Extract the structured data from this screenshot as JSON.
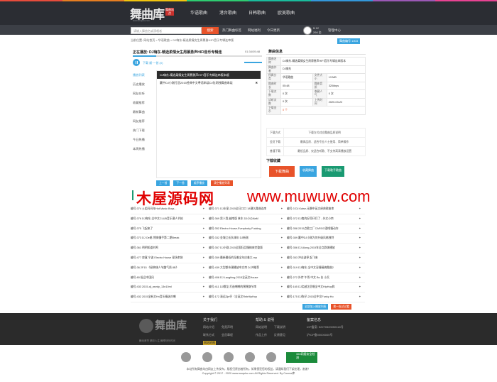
{
  "header": {
    "logo_main": "舞曲库",
    "logo_badge": "舞曲站点",
    "logo_sub": "www.wuquku.com",
    "nav": [
      "华语歌曲",
      "港台歌曲",
      "日韩歌曲",
      "欧美歌曲"
    ]
  },
  "subbar": {
    "search_placeholder": "请输入舞曲名或演唱者",
    "search_button": "搜索",
    "tools": [
      "热门舞曲标签",
      "网站福利",
      "今日更新"
    ],
    "user_line1": "♥ 12",
    "user_line2": "266 金",
    "user_menu": "管理中心"
  },
  "breadcrumb": "当前位置: 网站首页 > 华语歌曲 > DJ嗨东-精选柔情女生周慕勇HIFI音乐专辑连串版",
  "song_id": "舞曲编号 1003",
  "player": {
    "now_playing": "正在播放: DJ嗨东-精选柔情女生周慕勇声HIFI音乐专辑连",
    "time": "01:34/05:48",
    "progress": 0.18,
    "controls": "下载   顺·一首   (0)",
    "tabs": [
      "播放列表",
      "历史播放",
      "网友在听",
      "收藏推荐",
      "最新舞曲",
      "网友推荐",
      "热门下载",
      "今日热播",
      "本周热播"
    ],
    "playlist": [
      {
        "title": "DJ嗨东-精选柔情女生周慕勇声HIFI音乐专辑连串版本顺",
        "active": true
      },
      {
        "title": "赢中DJ小刚打造2015经典中文粤语串烧DJ包网独舞曲串烧",
        "active": false
      }
    ],
    "buttons": [
      "上一首",
      "下一首",
      "顺序播放",
      "清空播放列表"
    ]
  },
  "info": {
    "title": "舞曲信息",
    "rows": [
      {
        "k": "舞曲名称",
        "v": "DJ嗨东-精选柔情女生周慕勇声HIFI音乐专辑连串版本"
      },
      {
        "k": "舞曲作者",
        "v": "DJ嗨东"
      },
      {
        "k": "所属分类",
        "v": "华语歌曲",
        "k2": "文件大小",
        "v2": "13 MB"
      },
      {
        "k": "舞曲时长",
        "v": "05:48",
        "k2": "舞曲音质",
        "v2": "320kbps"
      },
      {
        "k": "下载次数",
        "v": "0 次",
        "k2": "收藏人气",
        "v2": "0 次"
      },
      {
        "k": "试听次数",
        "v": "0 次",
        "k2": "上传时间",
        "v2": "2020-03-22"
      },
      {
        "k": "下载金币",
        "v": "0 个"
      }
    ]
  },
  "download": {
    "header": [
      "下载方式",
      "下载方式对应舞曲品质说明"
    ],
    "rows": [
      [
        "会员下载",
        "最高品质、适合专业人士使用、简单操作"
      ],
      [
        "普通下载",
        "最低品质、仅适合听歌、不支持高清播放设置"
      ]
    ],
    "title": "下载收藏",
    "buttons": [
      "下载舞曲",
      "收藏舞曲",
      "下载歌手歌曲"
    ]
  },
  "watermark": {
    "left": "木屋源码网",
    "right": "www.muwuw.com"
  },
  "grid": [
    [
      "编号:374  土姐玛玛年Hot Music Boys...",
      "编号:371  DJ水皇-2015全日口口 18潮久舞曲连串",
      "编号:3  DJ.Kaise-无懈中英文经典歌曲串"
    ],
    [
      "编号:376  DJ嗨东-全中文CLUB音乐潮人节拍",
      "编号:369  男人我 越南版 林东 DJ小公NaM",
      "编号:372  DJ鬼的好奇仔们了 - 外文小串"
    ],
    [
      "编号:375  飞起来了",
      "编号:352  Electro House-Everybody Fucking",
      "编号:358  2015点歌工厂CARGO酒吧慢动作"
    ],
    [
      "编号:373  DJ Oe蛤-熊嗨慢手第二期Break",
      "编号:332  金城江长队嗨年 DJ新刚",
      "编号:359  赢中DJ小刚为何升级风格独特"
    ],
    [
      "编号:361  明明知道刘鸣",
      "编号:357  DJ小刚-2015全国狂品慢搞来完整版",
      "编号:356  DJ.Along-2015年全点群体播放"
    ],
    [
      "编号:477  寂寞 宁波 Electro House 现场串烧",
      "编号:359  最新最低的深着全年应着大.mp",
      "编号:353  冲击波停 起飞来"
    ],
    [
      "编号:36   2F15 《经典嗨人节趣气质 8B》",
      "编号:439  大型都市潮播放中文串 DJ冲推荐",
      "编号:319  DJ嗨东-全中文深情精搞舞曲2"
    ],
    [
      "编号:80   极品中国风",
      "编号:406  DJ Laughing-2015全英文House",
      "编号:272  外传 午哥 中文 Bs 台 小兵"
    ],
    [
      "编号:433  2015-dj_wordy_13n10ml",
      "编号:411  DJ嘟龙-打造嘲嘲的嘿嘿旗节串",
      "编号:165  DJ笑越芷愿唱全中文HipHop和"
    ],
    [
      "编号:432  2015全新文Hn音乐精选刘嘲",
      "编号:172  清远Dje仔（全英文RnbHipHop",
      "编号:175  DJ陈仔-2015全中文Funky Ho"
    ]
  ],
  "bottom_buttons": [
    "全部加入播放列表",
    "换一批试试看"
  ],
  "footer": {
    "logo": "舞曲库",
    "slogan": "舞动音符 精彩人生 舞享快乐时光",
    "col1": {
      "title": "关于我们",
      "lines": [
        [
          "网站介绍",
          "免责声明"
        ],
        [
          "联系方式",
          "会员章程"
        ],
        [
          "网站地图"
        ]
      ]
    },
    "col2": {
      "title": "帮助 & 说明",
      "lines": [
        [
          "网站说明",
          "下载说明"
        ],
        [
          "作品上传",
          "反馈意见"
        ]
      ]
    },
    "col3": {
      "title": "备案信息",
      "lines": [
        [
          "ICP备案: 52270520050118号"
        ],
        [
          "沪ICP备00000000号"
        ]
      ]
    }
  },
  "safe_badge": "360网盾安全检测",
  "copyright_1": "本站所有舞曲均由网友上传发布，版权归原创者所有。如果侵犯您的权益，请通知我们下架处理，谢谢！",
  "copyright_2": "Copyright © 2017 - 2020 www.wuquku.com All Rights Reserved. By Cooma库"
}
